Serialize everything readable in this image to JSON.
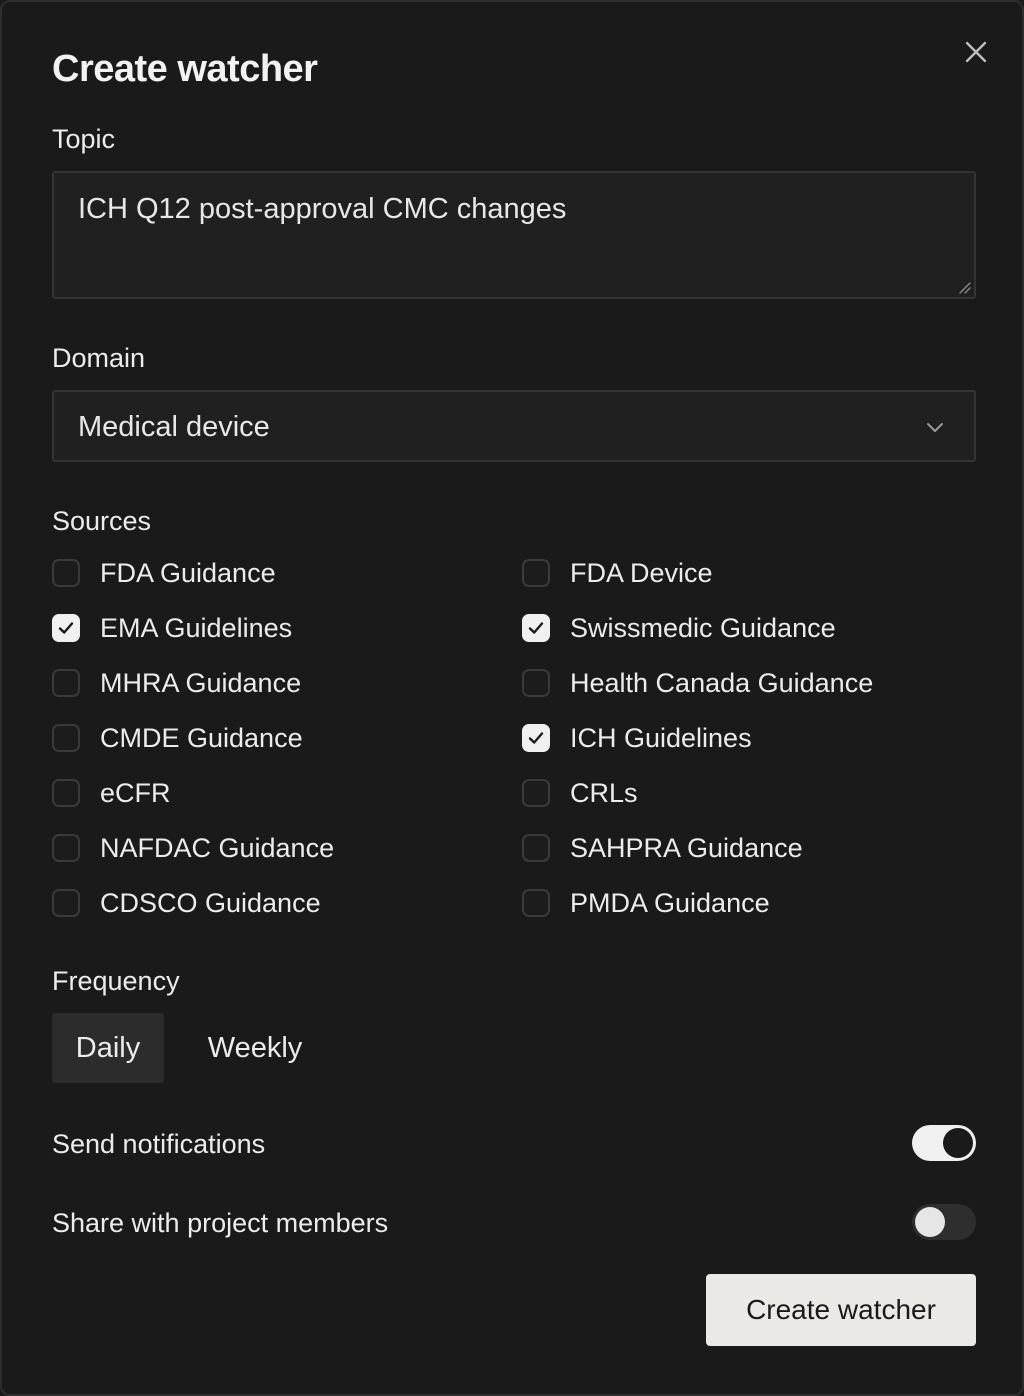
{
  "dialog": {
    "title": "Create watcher",
    "close_icon": "close-icon"
  },
  "topic": {
    "label": "Topic",
    "value": "ICH Q12 post-approval CMC changes"
  },
  "domain": {
    "label": "Domain",
    "selected": "Medical device",
    "icon": "chevron-down-icon"
  },
  "sources": {
    "label": "Sources",
    "left": [
      {
        "label": "FDA Guidance",
        "checked": false
      },
      {
        "label": "EMA Guidelines",
        "checked": true
      },
      {
        "label": "MHRA Guidance",
        "checked": false
      },
      {
        "label": "CMDE Guidance",
        "checked": false
      },
      {
        "label": "eCFR",
        "checked": false
      },
      {
        "label": "NAFDAC Guidance",
        "checked": false
      },
      {
        "label": "CDSCO Guidance",
        "checked": false
      }
    ],
    "right": [
      {
        "label": "FDA Device",
        "checked": false
      },
      {
        "label": "Swissmedic Guidance",
        "checked": true
      },
      {
        "label": "Health Canada Guidance",
        "checked": false
      },
      {
        "label": "ICH Guidelines",
        "checked": true
      },
      {
        "label": "CRLs",
        "checked": false
      },
      {
        "label": "SAHPRA Guidance",
        "checked": false
      },
      {
        "label": "PMDA Guidance",
        "checked": false
      }
    ]
  },
  "frequency": {
    "label": "Frequency",
    "options": [
      "Daily",
      "Weekly"
    ],
    "selected": "Daily"
  },
  "notifications": {
    "label": "Send notifications",
    "on": true
  },
  "share": {
    "label": "Share with project members",
    "on": false
  },
  "submit_label": "Create watcher",
  "colors": {
    "background": "#1a1a1b",
    "field": "#202021",
    "primary_button": "#ebe9e6",
    "text": "#ececec"
  }
}
